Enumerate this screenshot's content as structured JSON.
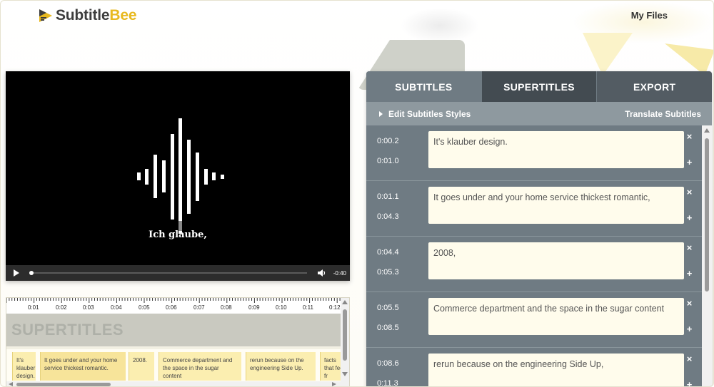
{
  "app": {
    "logo_part1": "Subtitle",
    "logo_part2": "Bee",
    "brand_color": "#e8b91f"
  },
  "header": {
    "my_files": "My Files"
  },
  "video": {
    "caption": "Ich glaube,",
    "time_remaining": "-0:40",
    "progress": 0.0
  },
  "timeline": {
    "ticks": [
      "0:01",
      "0:02",
      "0:03",
      "0:04",
      "0:05",
      "0:06",
      "0:07",
      "0:08",
      "0:09",
      "0:10",
      "0:11",
      "0:12"
    ],
    "supertitles_label": "SUPERTITLES",
    "clips": [
      "It's klauber design.",
      "It goes under and your home service thickest romantic.",
      "2008.",
      "Commerce department and the space in the sugar content",
      "rerun because on the engineering Side Up.",
      "facts that feel fr"
    ]
  },
  "panel": {
    "tabs": [
      "SUBTITLES",
      "SUPERTITLES",
      "EXPORT"
    ],
    "edit_styles": "Edit Subtitles Styles",
    "translate": "Translate Subtitles",
    "rows": [
      {
        "start": "0:00.2",
        "end": "0:01.0",
        "text": "It's klauber design."
      },
      {
        "start": "0:01.1",
        "end": "0:04.3",
        "text": "It goes under and your home service thickest romantic,"
      },
      {
        "start": "0:04.4",
        "end": "0:05.3",
        "text": "2008,"
      },
      {
        "start": "0:05.5",
        "end": "0:08.5",
        "text": "Commerce department and the space in the sugar content"
      },
      {
        "start": "0:08.6",
        "end": "0:11.3",
        "text": "rerun because on the engineering Side Up,"
      }
    ],
    "remove_glyph": "×",
    "add_glyph": "+"
  }
}
